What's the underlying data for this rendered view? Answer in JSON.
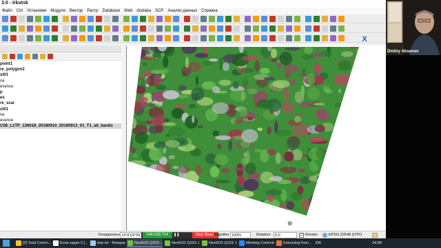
{
  "window": {
    "title": "3.0 - Irkutsk"
  },
  "menu": [
    "Файл",
    "Ctrl",
    "Установки",
    "Модули",
    "Вектор",
    "Растр",
    "Database",
    "Web",
    "dzeiaka",
    "SCP",
    "Анализ данных",
    "Справка"
  ],
  "layers_panel": {
    "close": "×",
    "items": [
      {
        "label": "point1",
        "style": "bold"
      },
      {
        "label": "re_polygon2",
        "style": "bold"
      },
      {
        "label": "st01",
        "style": "bold"
      },
      {
        "label": "ne",
        "style": "normal"
      },
      {
        "label": "esence",
        "style": "normal"
      },
      {
        "label": "p",
        "style": "bold"
      },
      {
        "label": "es",
        "style": "bold"
      },
      {
        "label": "re_scar",
        "style": "bold"
      },
      {
        "label": "st01",
        "style": "bold"
      },
      {
        "label": "ne",
        "style": "normal"
      },
      {
        "label": "esence",
        "style": "normal"
      },
      {
        "label": "C08_L1TP_136018_20180910_20180913_01_T1_all_bands",
        "style": "highlight"
      }
    ]
  },
  "toolbar": {
    "close_label": "X"
  },
  "statusbar": {
    "coord_label": "Координаты",
    "coord_value": "14°8,59°59'",
    "scale_label": "Magnifier",
    "magnifier_value": "100%",
    "rotation_label": "Rotation",
    "rotation_value": "0,0",
    "render_label": "Render",
    "render_checked": "✓",
    "epsg_label": "EPSG:32648 (OTF)"
  },
  "screenshare": {
    "meeting_id": "646-035-724",
    "stop_label": "Stop Share"
  },
  "video": {
    "participant_name": "Dmitry Aksenov"
  },
  "taskbar": {
    "items": [
      {
        "label": "[2] Total Comm...",
        "active": false,
        "color": "#f4c430"
      },
      {
        "label": "Блок задач 2 [...",
        "active": false,
        "color": "#ffffff"
      },
      {
        "label": "tmp.txt - Notepad",
        "active": false,
        "color": "#9ec9ef"
      },
      {
        "label": "NextGIS QGIS ...",
        "active": true,
        "color": "#7cc242"
      },
      {
        "label": "NextGIS QGIS 1...",
        "active": false,
        "color": "#7cc242"
      },
      {
        "label": "NextGIS QGIS 1...",
        "active": false,
        "color": "#7cc242"
      },
      {
        "label": "Meeting Controls",
        "active": false,
        "color": "#2d8cff"
      },
      {
        "label": "Extracting from ...",
        "active": false,
        "color": "#e07a3c"
      }
    ],
    "lang": "EN",
    "time": "14:09"
  }
}
